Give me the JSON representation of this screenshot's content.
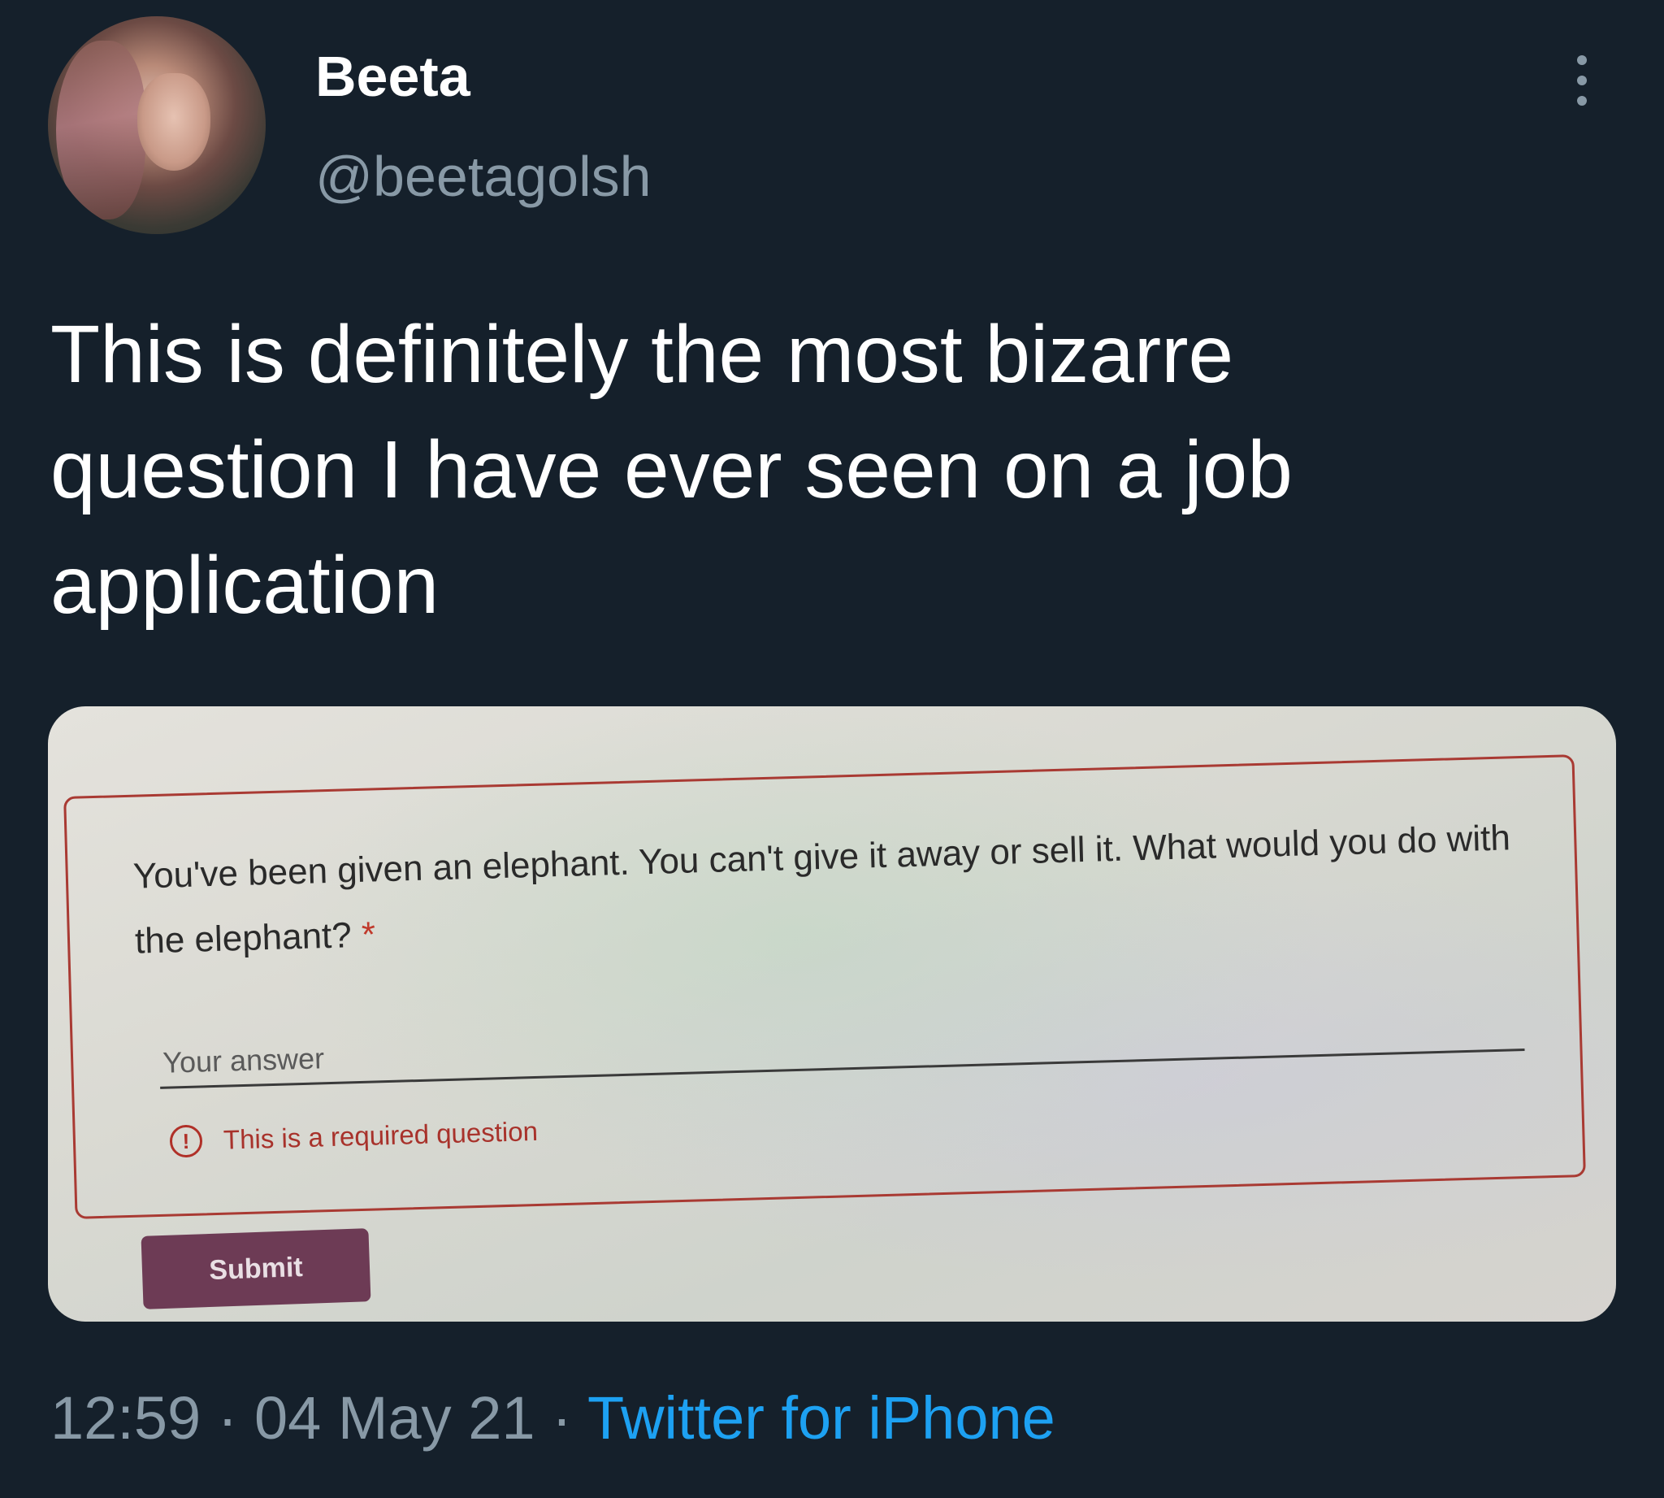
{
  "user": {
    "display_name": "Beeta",
    "handle": "@beetagolsh"
  },
  "tweet": {
    "text": "This is definitely the most bizarre\nquestion I have ever seen on a job\napplication"
  },
  "media": {
    "question": "You've been given an elephant. You can't give it away or sell it. What would you do with the elephant?",
    "required_marker": "*",
    "answer_placeholder": "Your answer",
    "error_icon_glyph": "!",
    "error_message": "This is a required question",
    "submit_label": "Submit"
  },
  "meta": {
    "time": "12:59",
    "separator": "·",
    "date": "04 May 21",
    "source": "Twitter for iPhone"
  },
  "colors": {
    "background": "#15202b",
    "secondary_text": "#8899a6",
    "link": "#1da1f2",
    "form_border": "#a93a33",
    "submit_button": "#6d3b55"
  }
}
